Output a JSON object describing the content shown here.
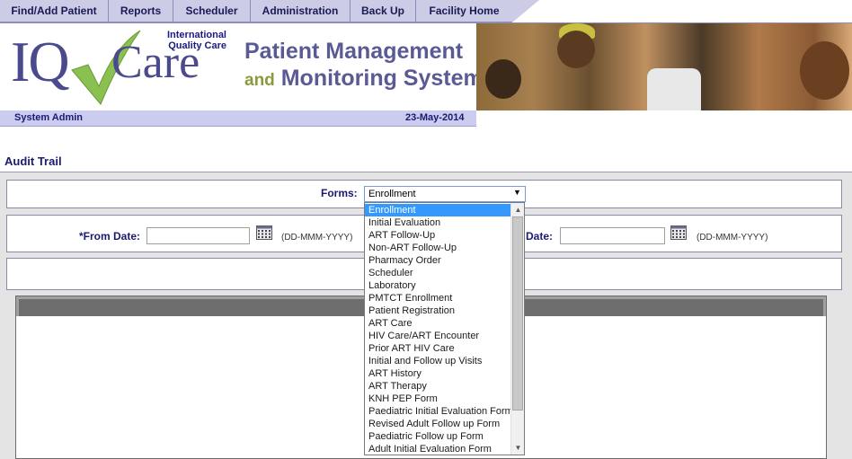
{
  "nav": {
    "tabs": [
      {
        "label": "Find/Add Patient"
      },
      {
        "label": "Reports"
      },
      {
        "label": "Scheduler"
      },
      {
        "label": "Administration"
      },
      {
        "label": "Back Up"
      },
      {
        "label": "Facility Home"
      }
    ]
  },
  "header": {
    "logo_iq": "IQ",
    "logo_care": "Care",
    "logo_tagline_1": "International",
    "logo_tagline_2": "Quality Care",
    "title_line1": "Patient Management",
    "title_and": "and",
    "title_line2": "Monitoring System"
  },
  "infobar": {
    "user": "System Admin",
    "date": "23-May-2014"
  },
  "page": {
    "title": "Audit Trail"
  },
  "form": {
    "forms_label": "Forms:",
    "forms_selected": "Enrollment",
    "from_date_label": "*From Date:",
    "to_date_label": "Date:",
    "date_format_hint": "(DD-MMM-YYYY)",
    "from_date_value": "",
    "to_date_value": ""
  },
  "dropdown": {
    "options": [
      "Enrollment",
      "Initial Evaluation",
      "ART Follow-Up",
      "Non-ART Follow-Up",
      "Pharmacy Order",
      "Scheduler",
      "Laboratory",
      "PMTCT Enrollment",
      "Patient Registration",
      "ART Care",
      "HIV Care/ART Encounter",
      "Prior ART HIV Care",
      "Initial and Follow up Visits",
      "ART History",
      "ART Therapy",
      "KNH PEP Form",
      "Paediatric Initial Evaluation Form",
      "Revised Adult Follow up Form",
      "Paediatric Follow up Form",
      "Adult Initial Evaluation Form"
    ],
    "selected_index": 0
  },
  "icons": {
    "calendar": "calendar-icon",
    "dropdown_arrow": "chevron-down-icon",
    "scroll_up": "arrow-up-icon",
    "scroll_down": "arrow-down-icon"
  }
}
